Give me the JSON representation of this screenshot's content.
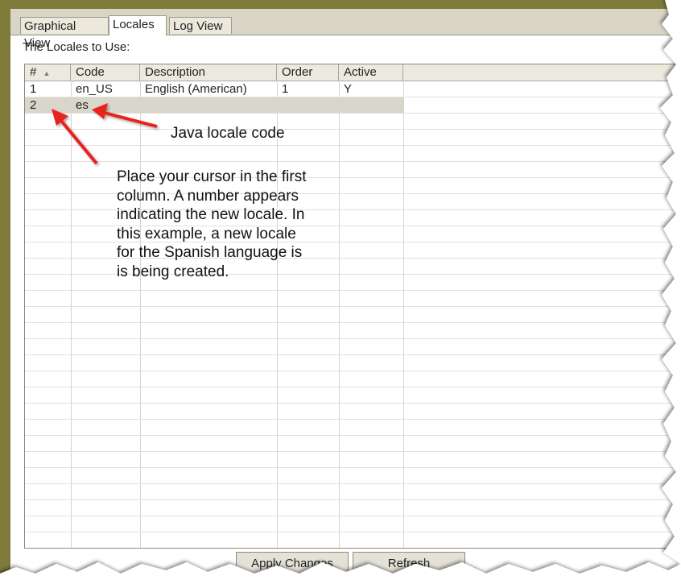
{
  "tabs": [
    {
      "label": "Graphical View",
      "active": false
    },
    {
      "label": "Locales",
      "active": true
    },
    {
      "label": "Log View",
      "active": false
    }
  ],
  "section_label": "The Locales to Use:",
  "grid": {
    "columns": [
      "#",
      "Code",
      "Description",
      "Order",
      "Active"
    ],
    "sort_indicator": "▲",
    "rows": [
      {
        "num": "1",
        "code": "en_US",
        "description": "English (American)",
        "order": "1",
        "active": "Y"
      },
      {
        "num": "2",
        "code": "es",
        "description": "",
        "order": "",
        "active": ""
      }
    ]
  },
  "buttons": {
    "apply": "Apply Changes",
    "refresh": "Refresh"
  },
  "annotations": {
    "java_code": "Java locale code",
    "cursor_note": "Place your cursor in the first\ncolumn. A number appears\nindicating the new locale. In\nthis example, a new locale\nfor the Spanish language is\nis being created."
  },
  "colors": {
    "frame": "#7d7a3a",
    "arrow": "#e8231c",
    "selected_row": "#d9d6cc"
  }
}
